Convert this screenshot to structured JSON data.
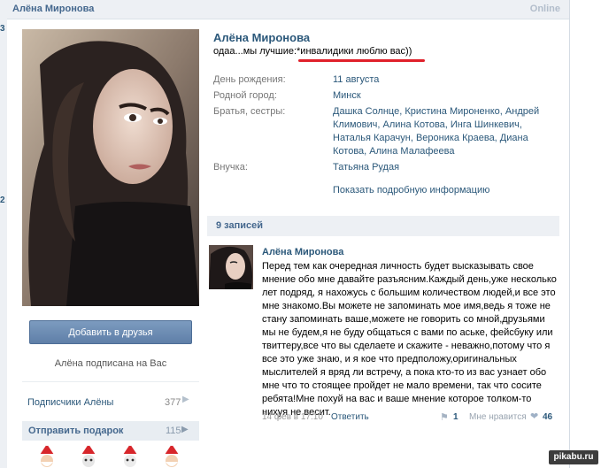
{
  "header": {
    "title": "Алёна Миронова",
    "online": "Online"
  },
  "left_strip": {
    "nums": [
      "3",
      "2"
    ]
  },
  "profile": {
    "name": "Алёна Миронова",
    "status": "одаа...мы лучшие:*инвалидики люблю вас))",
    "rows": [
      {
        "label": "День рождения:",
        "value": "11 августа"
      },
      {
        "label": "Родной город:",
        "value": "Минск"
      },
      {
        "label": "Братья, сестры:",
        "value": "Дашка Солнце, Кристина Мироненко, Андрей Климович, Алина Котова, Инга Шинкевич, Наталья Карачун, Вероника Краева, Диана Котова, Алина Малафеева"
      },
      {
        "label": "Внучка:",
        "value": "Татьяна Рудая"
      }
    ],
    "more_info": "Показать подробную информацию"
  },
  "sidebar": {
    "add_friend": "Добавить в друзья",
    "subscribed": "Алёна подписана на Вас",
    "followers_label": "Подписчики Алёны",
    "followers_count": "377",
    "gifts_label": "Отправить подарок",
    "gifts_count": "115"
  },
  "wall": {
    "posts_count": "9 записей",
    "post": {
      "author": "Алёна Миронова",
      "text": "Перед тем как очередная личность будет высказывать свое мнение обо мне давайте разъясним.Каждый день,уже несколько лет подряд, я нахожусь с большим количеством людей,и все это мне знакомо.Вы можете не запоминать мое имя,ведь я тоже не стану запоминать ваше,можете не говорить со мной,друзьями мы не будем,я не буду общаться с вами по аське, фейсбуку или твиттеру,все что вы сделаете и скажите - неважно,потому что я все это уже знаю, и я кое что предположу,оригинальных мыслителей я вряд ли встречу, а пока кто-то из вас узнает обо мне что то стоящее пройдет не мало времени, так что сосите ребята!Мне похуй на вас и ваше мнение которое толком-то нихуя не весит.",
      "date": "14 фев в 17:10",
      "reply": "Ответить",
      "shares": "1",
      "like_label": "Мне нравится",
      "likes": "46"
    }
  },
  "watermark": "pikabu.ru",
  "icons": [
    "share-icon",
    "heart-icon",
    "chevron-right-icon",
    "gift-santa-icon"
  ],
  "colors": {
    "link": "#2b587a",
    "header": "#45688e",
    "button": "#5f7fa8",
    "underline": "#e0202a"
  }
}
